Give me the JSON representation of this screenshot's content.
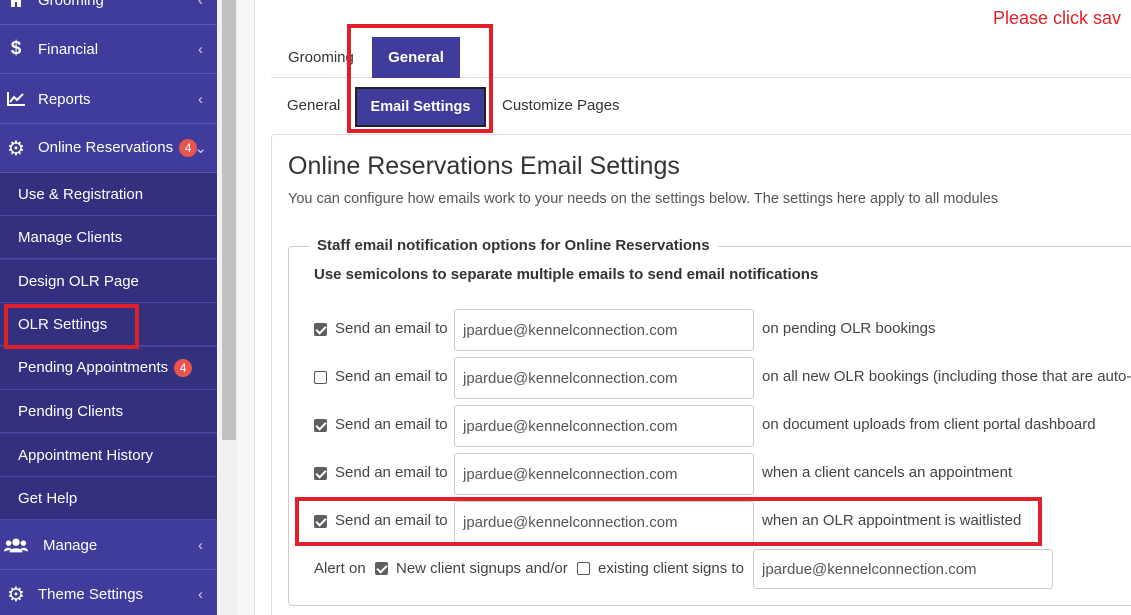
{
  "sidebar": {
    "items": [
      {
        "label": "Grooming",
        "icon": "home-icon"
      },
      {
        "label": "Financial",
        "icon": "dollar-icon"
      },
      {
        "label": "Reports",
        "icon": "chart-icon"
      },
      {
        "label": "Online Reservations",
        "icon": "gear-icon",
        "badge": "4"
      },
      {
        "label": "Manage",
        "icon": "users-icon"
      },
      {
        "label": "Theme Settings",
        "icon": "gear-icon"
      }
    ],
    "subitems": [
      {
        "label": "Use & Registration"
      },
      {
        "label": "Manage Clients"
      },
      {
        "label": "Design OLR Page"
      },
      {
        "label": "OLR Settings"
      },
      {
        "label": "Pending Appointments",
        "badge": "4"
      },
      {
        "label": "Pending Clients"
      },
      {
        "label": "Appointment History"
      },
      {
        "label": "Get Help"
      }
    ]
  },
  "notice": "Please click sav",
  "tabs": {
    "top": [
      "Grooming",
      "General"
    ],
    "sub": [
      "General",
      "Email Settings",
      "Customize Pages"
    ]
  },
  "panel": {
    "title": "Online Reservations Email Settings",
    "description": "You can configure how emails work to your needs on the settings below. The settings here apply to all modules",
    "legend": "Staff email notification options for Online Reservations",
    "hint": "Use semicolons to separate multiple emails to send email notifications",
    "rows": [
      {
        "checked": true,
        "label": "Send an email to",
        "email": "jpardue@kennelconnection.com",
        "tail": "on pending OLR bookings"
      },
      {
        "checked": false,
        "label": "Send an email to",
        "email": "jpardue@kennelconnection.com",
        "tail": "on all new OLR bookings (including those that are auto-"
      },
      {
        "checked": true,
        "label": "Send an email to",
        "email": "jpardue@kennelconnection.com",
        "tail": "on document uploads from client portal dashboard"
      },
      {
        "checked": true,
        "label": "Send an email to",
        "email": "jpardue@kennelconnection.com",
        "tail": "when a client cancels an appointment"
      },
      {
        "checked": true,
        "label": "Send an email to",
        "email": "jpardue@kennelconnection.com",
        "tail": "when an OLR appointment is waitlisted"
      }
    ],
    "alert": {
      "prefix": "Alert on",
      "new_label": "New client signups and/or",
      "new_checked": true,
      "existing_label": "existing client signs to",
      "existing_checked": false,
      "email": "jpardue@kennelconnection.com"
    }
  },
  "colors": {
    "sidebar": "#3f3c9c",
    "subnav": "#33307f",
    "accent": "#3f3c9c",
    "highlight": "#e0202a",
    "badge": "#e9544f"
  }
}
